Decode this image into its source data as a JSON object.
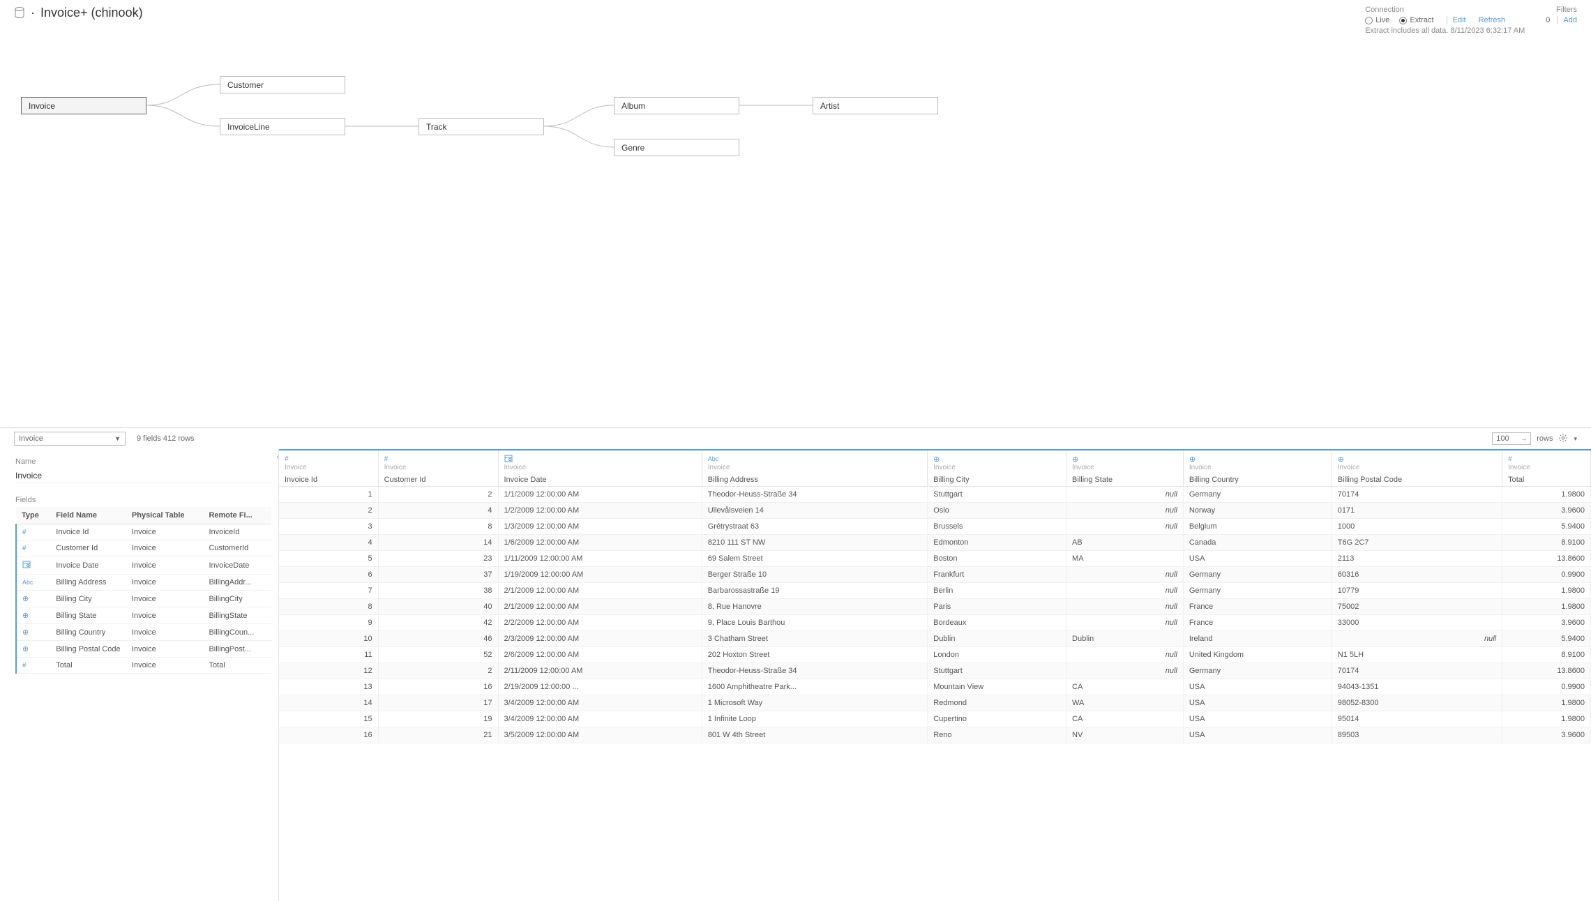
{
  "header": {
    "title": "Invoice+ (chinook)",
    "dot": "·"
  },
  "connection": {
    "label": "Connection",
    "live": "Live",
    "extract": "Extract",
    "edit": "Edit",
    "refresh": "Refresh",
    "note": "Extract includes all data. 8/11/2023 6:32:17 AM"
  },
  "filters": {
    "label": "Filters",
    "count": "0",
    "add": "Add"
  },
  "nodes": {
    "invoice": "Invoice",
    "customer": "Customer",
    "invoiceline": "InvoiceLine",
    "track": "Track",
    "album": "Album",
    "genre": "Genre",
    "artist": "Artist"
  },
  "midbar": {
    "selector": "Invoice",
    "summary": "9 fields 412 rows",
    "rowcount": "100",
    "rows_label": "rows"
  },
  "leftpanel": {
    "name_label": "Name",
    "name_value": "Invoice",
    "fields_label": "Fields",
    "headers": {
      "type": "Type",
      "field": "Field Name",
      "phys": "Physical Table",
      "remote": "Remote Fi..."
    },
    "rows": [
      {
        "t": "#",
        "f": "Invoice Id",
        "p": "Invoice",
        "r": "InvoiceId"
      },
      {
        "t": "#",
        "f": "Customer Id",
        "p": "Invoice",
        "r": "CustomerId"
      },
      {
        "t": "cal",
        "f": "Invoice Date",
        "p": "Invoice",
        "r": "InvoiceDate"
      },
      {
        "t": "abc",
        "f": "Billing Address",
        "p": "Invoice",
        "r": "BillingAddr..."
      },
      {
        "t": "globe",
        "f": "Billing City",
        "p": "Invoice",
        "r": "BillingCity"
      },
      {
        "t": "globe",
        "f": "Billing State",
        "p": "Invoice",
        "r": "BillingState"
      },
      {
        "t": "globe",
        "f": "Billing Country",
        "p": "Invoice",
        "r": "BillingCoun..."
      },
      {
        "t": "globe",
        "f": "Billing Postal Code",
        "p": "Invoice",
        "r": "BillingPost..."
      },
      {
        "t": "#",
        "f": "Total",
        "p": "Invoice",
        "r": "Total"
      }
    ]
  },
  "grid": {
    "src": "Invoice",
    "cols": [
      {
        "ico": "#",
        "name": "Invoice Id",
        "align": "num"
      },
      {
        "ico": "#",
        "name": "Customer Id",
        "align": "num"
      },
      {
        "ico": "cal",
        "name": "Invoice Date",
        "align": ""
      },
      {
        "ico": "abc",
        "name": "Billing Address",
        "align": ""
      },
      {
        "ico": "globe",
        "name": "Billing City",
        "align": ""
      },
      {
        "ico": "globe",
        "name": "Billing State",
        "align": ""
      },
      {
        "ico": "globe",
        "name": "Billing Country",
        "align": ""
      },
      {
        "ico": "globe",
        "name": "Billing Postal Code",
        "align": ""
      },
      {
        "ico": "#",
        "name": "Total",
        "align": "num"
      }
    ],
    "rows": [
      [
        "1",
        "2",
        "1/1/2009 12:00:00 AM",
        "Theodor-Heuss-Straße 34",
        "Stuttgart",
        null,
        "Germany",
        "70174",
        "1.9800"
      ],
      [
        "2",
        "4",
        "1/2/2009 12:00:00 AM",
        "Ullevålsveien 14",
        "Oslo",
        null,
        "Norway",
        "0171",
        "3.9600"
      ],
      [
        "3",
        "8",
        "1/3/2009 12:00:00 AM",
        "Grétrystraat 63",
        "Brussels",
        null,
        "Belgium",
        "1000",
        "5.9400"
      ],
      [
        "4",
        "14",
        "1/6/2009 12:00:00 AM",
        "8210 111 ST NW",
        "Edmonton",
        "AB",
        "Canada",
        "T6G 2C7",
        "8.9100"
      ],
      [
        "5",
        "23",
        "1/11/2009 12:00:00 AM",
        "69 Salem Street",
        "Boston",
        "MA",
        "USA",
        "2113",
        "13.8600"
      ],
      [
        "6",
        "37",
        "1/19/2009 12:00:00 AM",
        "Berger Straße 10",
        "Frankfurt",
        null,
        "Germany",
        "60316",
        "0.9900"
      ],
      [
        "7",
        "38",
        "2/1/2009 12:00:00 AM",
        "Barbarossastraße 19",
        "Berlin",
        null,
        "Germany",
        "10779",
        "1.9800"
      ],
      [
        "8",
        "40",
        "2/1/2009 12:00:00 AM",
        "8, Rue Hanovre",
        "Paris",
        null,
        "France",
        "75002",
        "1.9800"
      ],
      [
        "9",
        "42",
        "2/2/2009 12:00:00 AM",
        "9, Place Louis Barthou",
        "Bordeaux",
        null,
        "France",
        "33000",
        "3.9600"
      ],
      [
        "10",
        "46",
        "2/3/2009 12:00:00 AM",
        "3 Chatham Street",
        "Dublin",
        "Dublin",
        "Ireland",
        null,
        "5.9400"
      ],
      [
        "11",
        "52",
        "2/6/2009 12:00:00 AM",
        "202 Hoxton Street",
        "London",
        null,
        "United Kingdom",
        "N1 5LH",
        "8.9100"
      ],
      [
        "12",
        "2",
        "2/11/2009 12:00:00 AM",
        "Theodor-Heuss-Straße 34",
        "Stuttgart",
        null,
        "Germany",
        "70174",
        "13.8600"
      ],
      [
        "13",
        "16",
        "2/19/2009 12:00:00 ...",
        "1600 Amphitheatre Park...",
        "Mountain View",
        "CA",
        "USA",
        "94043-1351",
        "0.9900"
      ],
      [
        "14",
        "17",
        "3/4/2009 12:00:00 AM",
        "1 Microsoft Way",
        "Redmond",
        "WA",
        "USA",
        "98052-8300",
        "1.9800"
      ],
      [
        "15",
        "19",
        "3/4/2009 12:00:00 AM",
        "1 Infinite Loop",
        "Cupertino",
        "CA",
        "USA",
        "95014",
        "1.9800"
      ],
      [
        "16",
        "21",
        "3/5/2009 12:00:00 AM",
        "801 W 4th Street",
        "Reno",
        "NV",
        "USA",
        "89503",
        "3.9600"
      ]
    ]
  }
}
